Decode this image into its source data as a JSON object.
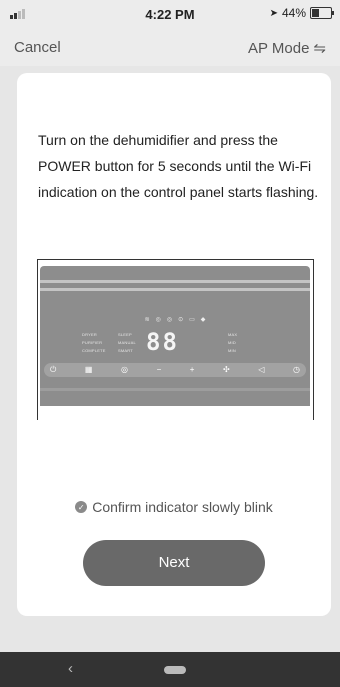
{
  "status_bar": {
    "time": "4:22 PM",
    "battery_percent": "44%",
    "battery_level": 0.44
  },
  "nav": {
    "cancel_label": "Cancel",
    "ap_mode_label": "AP Mode",
    "ap_mode_icon": "swap-arrows-icon"
  },
  "instructions": "Turn on the dehumidifier and press the POWER button for 5 seconds until the Wi-Fi indication on the control panel starts flashing.",
  "panel": {
    "display": "88",
    "left_labels": [
      "DRYER",
      "PURIFIER",
      "COMPLETE"
    ],
    "mode_labels": [
      "SLEEP",
      "MANUAL",
      "SMART"
    ],
    "right_labels": [
      "MAX",
      "MID",
      "MIN"
    ],
    "buttons": [
      "⏻",
      "▦",
      "◎",
      "−",
      "+",
      "✣",
      "◁",
      "◷"
    ]
  },
  "confirm_text": "Confirm indicator slowly blink",
  "next_label": "Next",
  "colors": {
    "button": "#696969",
    "card": "#ffffff",
    "background": "#e6e6e6"
  }
}
